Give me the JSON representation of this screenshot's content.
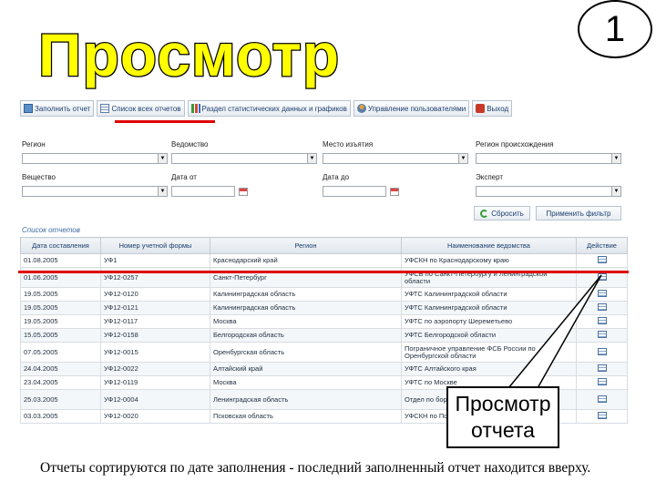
{
  "slide": {
    "title": "Просмотр отчетов",
    "badge": "1",
    "callout_line1": "Просмотр",
    "callout_line2": "отчета",
    "caption": "Отчеты сортируются по дате заполнения - последний заполненный отчет находится вверху."
  },
  "toolbar": {
    "fill_report": "Заполнить отчет",
    "report_list": "Список всех отчетов",
    "statistics": "Раздел статистических данных и графиков",
    "users": "Управление пользователями",
    "exit": "Выход"
  },
  "filters": {
    "region_label": "Регион",
    "agency_label": "Ведомство",
    "seizure_place_label": "Место изъятия",
    "origin_region_label": "Регион происхождения",
    "substance_label": "Вещество",
    "date_from_label": "Дата от",
    "date_to_label": "Дата до",
    "expert_label": "Эксперт",
    "reset_button": "Сбросить",
    "apply_button": "Применить фильтр"
  },
  "table": {
    "section_title": "Список отчетов",
    "headers": [
      "Дата составления",
      "Номер учетной формы",
      "Регион",
      "Наименование ведомства",
      "Действие"
    ],
    "rows": [
      {
        "date": "01.08.2005",
        "form": "УФ1",
        "region": "Краснодарский край",
        "agency": "УФСКН по Краснодарскому краю"
      },
      {
        "date": "01.06.2005",
        "form": "УФ12-0257",
        "region": "Санкт-Петербург",
        "agency": "УФСБ по Санкт-Петербургу и Ленинградской области"
      },
      {
        "date": "19.05.2005",
        "form": "УФ12-0120",
        "region": "Калининградская область",
        "agency": "УФТС Калининградской области"
      },
      {
        "date": "19.05.2005",
        "form": "УФ12-0121",
        "region": "Калининградская область",
        "agency": "УФТС Калининградской области"
      },
      {
        "date": "19.05.2005",
        "form": "УФ12-0117",
        "region": "Москва",
        "agency": "УФТС по аэропорту Шереметьево"
      },
      {
        "date": "15.05.2005",
        "form": "УФ12-0158",
        "region": "Белгородская область",
        "agency": "УФТС Белгородской области"
      },
      {
        "date": "07.05.2005",
        "form": "УФ12-0015",
        "region": "Оренбургская область",
        "agency": "Пограничное управление ФСБ России по Оренбургской области"
      },
      {
        "date": "24.04.2005",
        "form": "УФ12-0022",
        "region": "Алтайский край",
        "agency": "УФТС Алтайского края"
      },
      {
        "date": "23.04.2005",
        "form": "УФ12-0119",
        "region": "Москва",
        "agency": "УФТС по Москве"
      },
      {
        "date": "25.03.2005",
        "form": "УФ12-0004",
        "region": "Ленинградская область",
        "agency": "Отдел по борьбе с наркотиками"
      },
      {
        "date": "03.03.2005",
        "form": "УФ12-0020",
        "region": "Псковская область",
        "agency": "УФСКН по Псковской области"
      }
    ]
  }
}
